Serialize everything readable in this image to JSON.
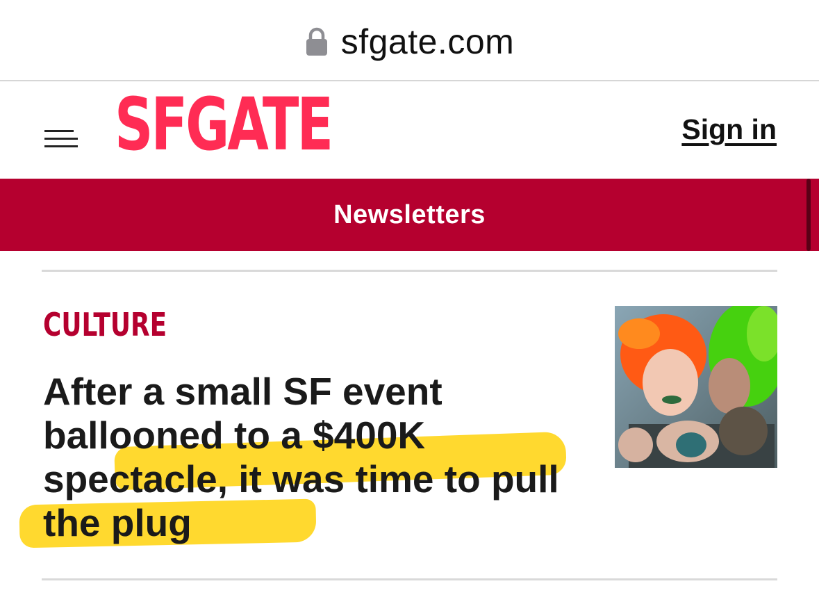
{
  "browser": {
    "url": "sfgate.com",
    "lock_icon": "lock-icon"
  },
  "header": {
    "logo": "SFGATE",
    "signin_label": "Sign in",
    "menu_icon": "hamburger-menu-icon",
    "logo_color": "#ff2c54"
  },
  "newsletters": {
    "label": "Newsletters",
    "bg_color": "#b5002f"
  },
  "article": {
    "kicker": "CULTURE",
    "headline": "After a small SF event ballooned to a $400K spectacle, it was time to pull the plug",
    "highlight_color": "#ffd20a",
    "thumbnail": "article-thumbnail-image"
  }
}
